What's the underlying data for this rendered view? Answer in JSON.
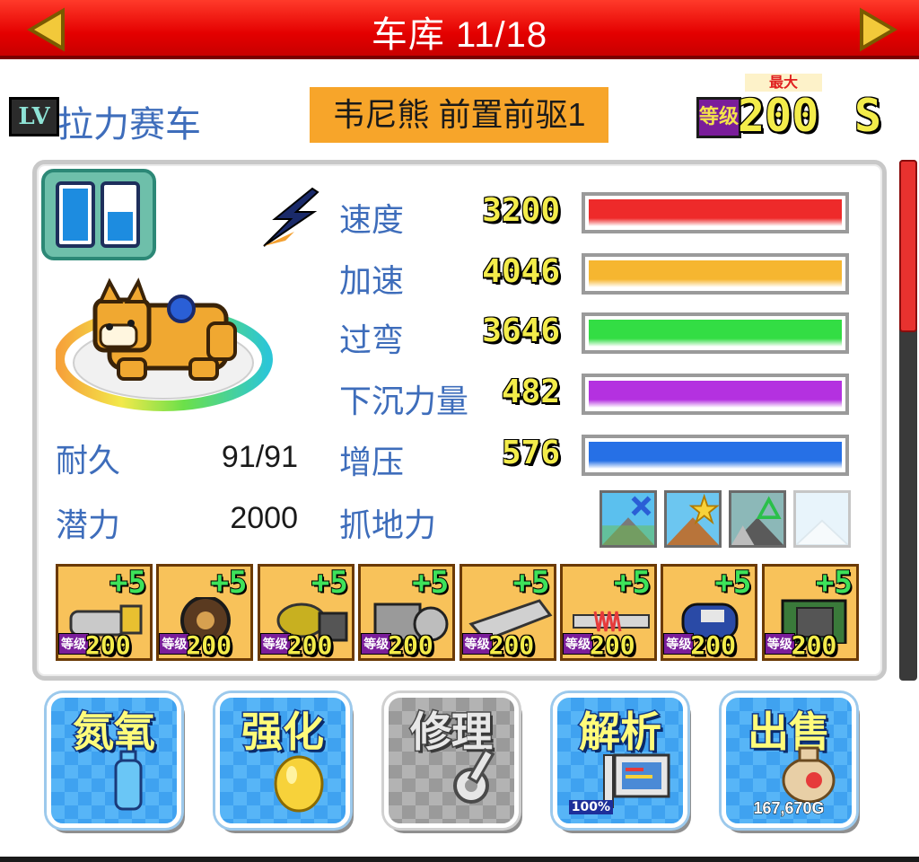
{
  "header": {
    "title": "车库 11/18"
  },
  "car": {
    "class_badge": "LV",
    "type": "拉力赛车",
    "name": "韦尼熊 前置前驱1",
    "max_label": "最大",
    "level_tag": "等级",
    "level": "200",
    "rank": "S",
    "fuel_levels": [
      1.0,
      0.6
    ]
  },
  "stats": [
    {
      "label": "速度",
      "value": "3200",
      "color": "#ee2a2a"
    },
    {
      "label": "加速",
      "value": "4046",
      "color": "#f6b630"
    },
    {
      "label": "过弯",
      "value": "3646",
      "color": "#33dd44"
    },
    {
      "label": "下沉力量",
      "value": "482",
      "color": "#b431e0"
    },
    {
      "label": "增压",
      "value": "576",
      "color": "#2670e6"
    }
  ],
  "attributes": {
    "durability_label": "耐久",
    "durability_value": "91/91",
    "potential_label": "潜力",
    "potential_value": "2000",
    "grip_label": "抓地力"
  },
  "terrains": [
    "road-no-icon",
    "dirt-star-icon",
    "snow-road-triangle-icon",
    "ice-blank-icon"
  ],
  "parts": [
    {
      "icon": "exhaust-part-icon",
      "plus": "+5",
      "level_tag": "等级",
      "level": "200"
    },
    {
      "icon": "tire-part-icon",
      "plus": "+5",
      "level_tag": "等级",
      "level": "200"
    },
    {
      "icon": "steering-part-icon",
      "plus": "+5",
      "level_tag": "等级",
      "level": "200"
    },
    {
      "icon": "engine-part-icon",
      "plus": "+5",
      "level_tag": "等级",
      "level": "200"
    },
    {
      "icon": "wing-part-icon",
      "plus": "+5",
      "level_tag": "等级",
      "level": "200"
    },
    {
      "icon": "suspension-part-icon",
      "plus": "+5",
      "level_tag": "等级",
      "level": "200"
    },
    {
      "icon": "nitro-tank-part-icon",
      "plus": "+5",
      "level_tag": "等级",
      "level": "200"
    },
    {
      "icon": "computer-chip-part-icon",
      "plus": "+5",
      "level_tag": "等级",
      "level": "200"
    }
  ],
  "buttons": {
    "nitro": {
      "label": "氮氧"
    },
    "upgrade": {
      "label": "强化"
    },
    "repair": {
      "label": "修理"
    },
    "analyze": {
      "label": "解析",
      "sub": "100%"
    },
    "sell": {
      "label": "出售",
      "price": "167,670G"
    }
  }
}
